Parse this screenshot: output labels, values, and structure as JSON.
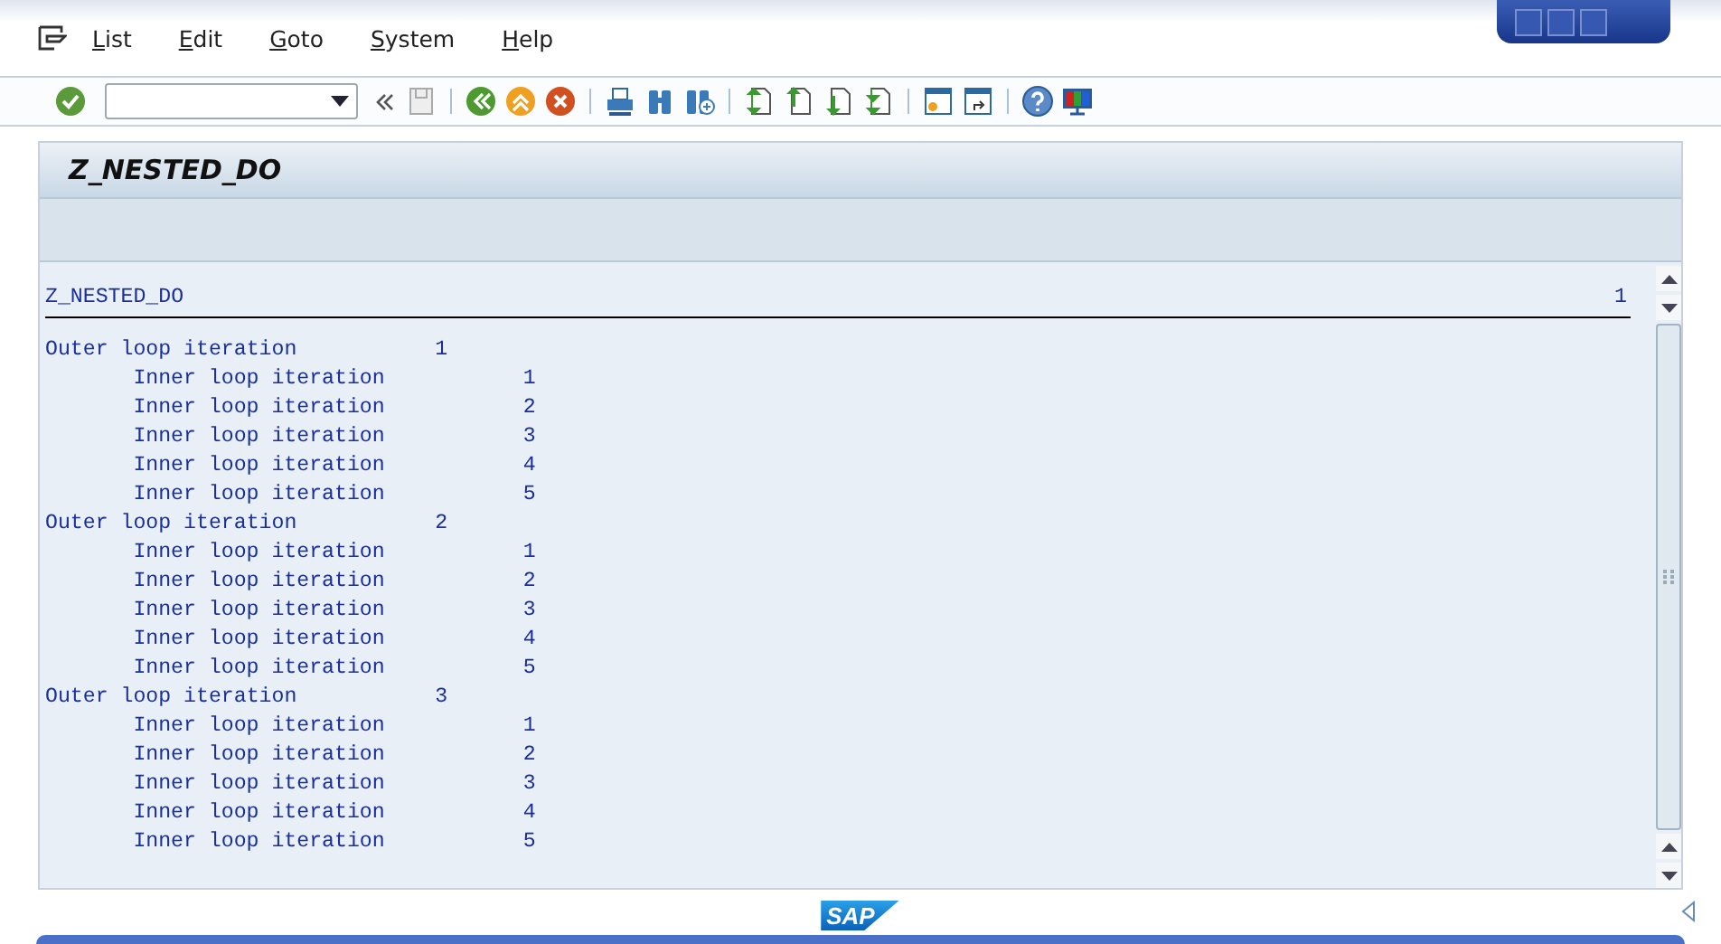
{
  "menu": [
    {
      "label": "List"
    },
    {
      "label": "Edit"
    },
    {
      "label": "Goto"
    },
    {
      "label": "System"
    },
    {
      "label": "Help"
    }
  ],
  "title": "Z_NESTED_DO",
  "list": {
    "header": "Z_NESTED_DO",
    "page": "1",
    "lines": [
      {
        "kind": "outer",
        "label": "Outer loop iteration",
        "value": "1"
      },
      {
        "kind": "inner",
        "label": "Inner loop iteration",
        "value": "1"
      },
      {
        "kind": "inner",
        "label": "Inner loop iteration",
        "value": "2"
      },
      {
        "kind": "inner",
        "label": "Inner loop iteration",
        "value": "3"
      },
      {
        "kind": "inner",
        "label": "Inner loop iteration",
        "value": "4"
      },
      {
        "kind": "inner",
        "label": "Inner loop iteration",
        "value": "5"
      },
      {
        "kind": "outer",
        "label": "Outer loop iteration",
        "value": "2"
      },
      {
        "kind": "inner",
        "label": "Inner loop iteration",
        "value": "1"
      },
      {
        "kind": "inner",
        "label": "Inner loop iteration",
        "value": "2"
      },
      {
        "kind": "inner",
        "label": "Inner loop iteration",
        "value": "3"
      },
      {
        "kind": "inner",
        "label": "Inner loop iteration",
        "value": "4"
      },
      {
        "kind": "inner",
        "label": "Inner loop iteration",
        "value": "5"
      },
      {
        "kind": "outer",
        "label": "Outer loop iteration",
        "value": "3"
      },
      {
        "kind": "inner",
        "label": "Inner loop iteration",
        "value": "1"
      },
      {
        "kind": "inner",
        "label": "Inner loop iteration",
        "value": "2"
      },
      {
        "kind": "inner",
        "label": "Inner loop iteration",
        "value": "3"
      },
      {
        "kind": "inner",
        "label": "Inner loop iteration",
        "value": "4"
      },
      {
        "kind": "inner",
        "label": "Inner loop iteration",
        "value": "5"
      }
    ]
  },
  "logo": "SAP"
}
